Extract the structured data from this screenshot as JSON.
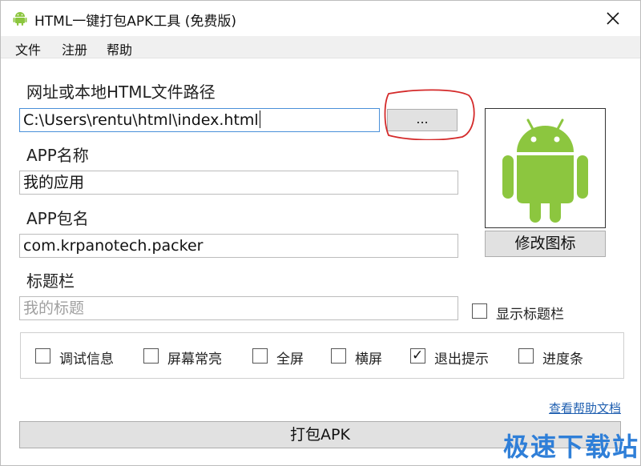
{
  "window": {
    "title": "HTML一键打包APK工具 (免费版)",
    "icon": "android-app-icon",
    "close_icon": "close-icon"
  },
  "menu": [
    "文件",
    "注册",
    "帮助"
  ],
  "form": {
    "url_label": "网址或本地HTML文件路径",
    "url_value": "C:\\Users\\rentu\\html\\index.html",
    "browse_label": "...",
    "app_name_label": "APP名称",
    "app_name_value": "我的应用",
    "package_label": "APP包名",
    "package_value": "com.krpanotech.packer",
    "titlebar_label": "标题栏",
    "title_placeholder": "我的标题",
    "show_titlebar_label": "显示标题栏",
    "show_titlebar_checked": false
  },
  "icon_panel": {
    "image": "android-robot-icon",
    "color": "#8cc63f",
    "change_icon_label": "修改图标"
  },
  "options": [
    {
      "label": "调试信息",
      "checked": false
    },
    {
      "label": "屏幕常亮",
      "checked": false
    },
    {
      "label": "全屏",
      "checked": false
    },
    {
      "label": "横屏",
      "checked": false
    },
    {
      "label": "退出提示",
      "checked": true
    },
    {
      "label": "进度条",
      "checked": false
    }
  ],
  "help_link": "查看帮助文档",
  "pack_button": "打包APK",
  "watermark": "极速下载站",
  "colors": {
    "annotation_red": "#d42a2a",
    "android_green": "#8cc63f",
    "link_blue": "#1f5fb0",
    "watermark_blue": "#2f7fd8"
  }
}
